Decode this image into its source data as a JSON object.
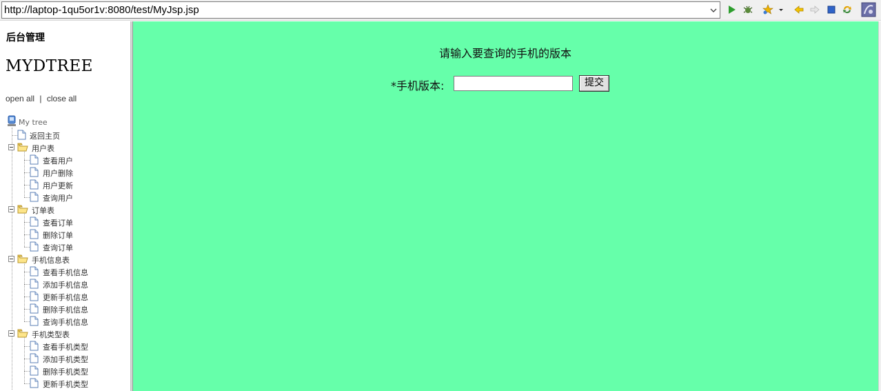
{
  "address_bar": {
    "url": "http://laptop-1qu5or1v:8080/test/MyJsp.jsp"
  },
  "toolbar_icons": [
    "run-icon",
    "debug-icon",
    "favorites-icon",
    "dropdown-icon",
    "back-icon",
    "forward-icon",
    "stop-icon",
    "refresh-icon",
    "eclipse-icon"
  ],
  "sidebar": {
    "admin_title": "后台管理",
    "tree_title": "MYDTREE",
    "open_all": "open all",
    "separator": "|",
    "close_all": "close all",
    "root": "My tree",
    "home": "返回主页",
    "groups": [
      {
        "label": "用户表",
        "items": [
          "查看用户",
          "用户删除",
          "用户更新",
          "查询用户"
        ]
      },
      {
        "label": "订单表",
        "items": [
          "查看订单",
          "删除订单",
          "查询订单"
        ]
      },
      {
        "label": "手机信息表",
        "items": [
          "查看手机信息",
          "添加手机信息",
          "更新手机信息",
          "删除手机信息",
          "查询手机信息"
        ]
      },
      {
        "label": "手机类型表",
        "items": [
          "查看手机类型",
          "添加手机类型",
          "删除手机类型",
          "更新手机类型"
        ]
      }
    ]
  },
  "main": {
    "prompt": "请输入要查询的手机的版本",
    "field_label": "*手机版本:",
    "field_value": "",
    "submit_label": "提交",
    "background_color": "#66ffaa"
  }
}
